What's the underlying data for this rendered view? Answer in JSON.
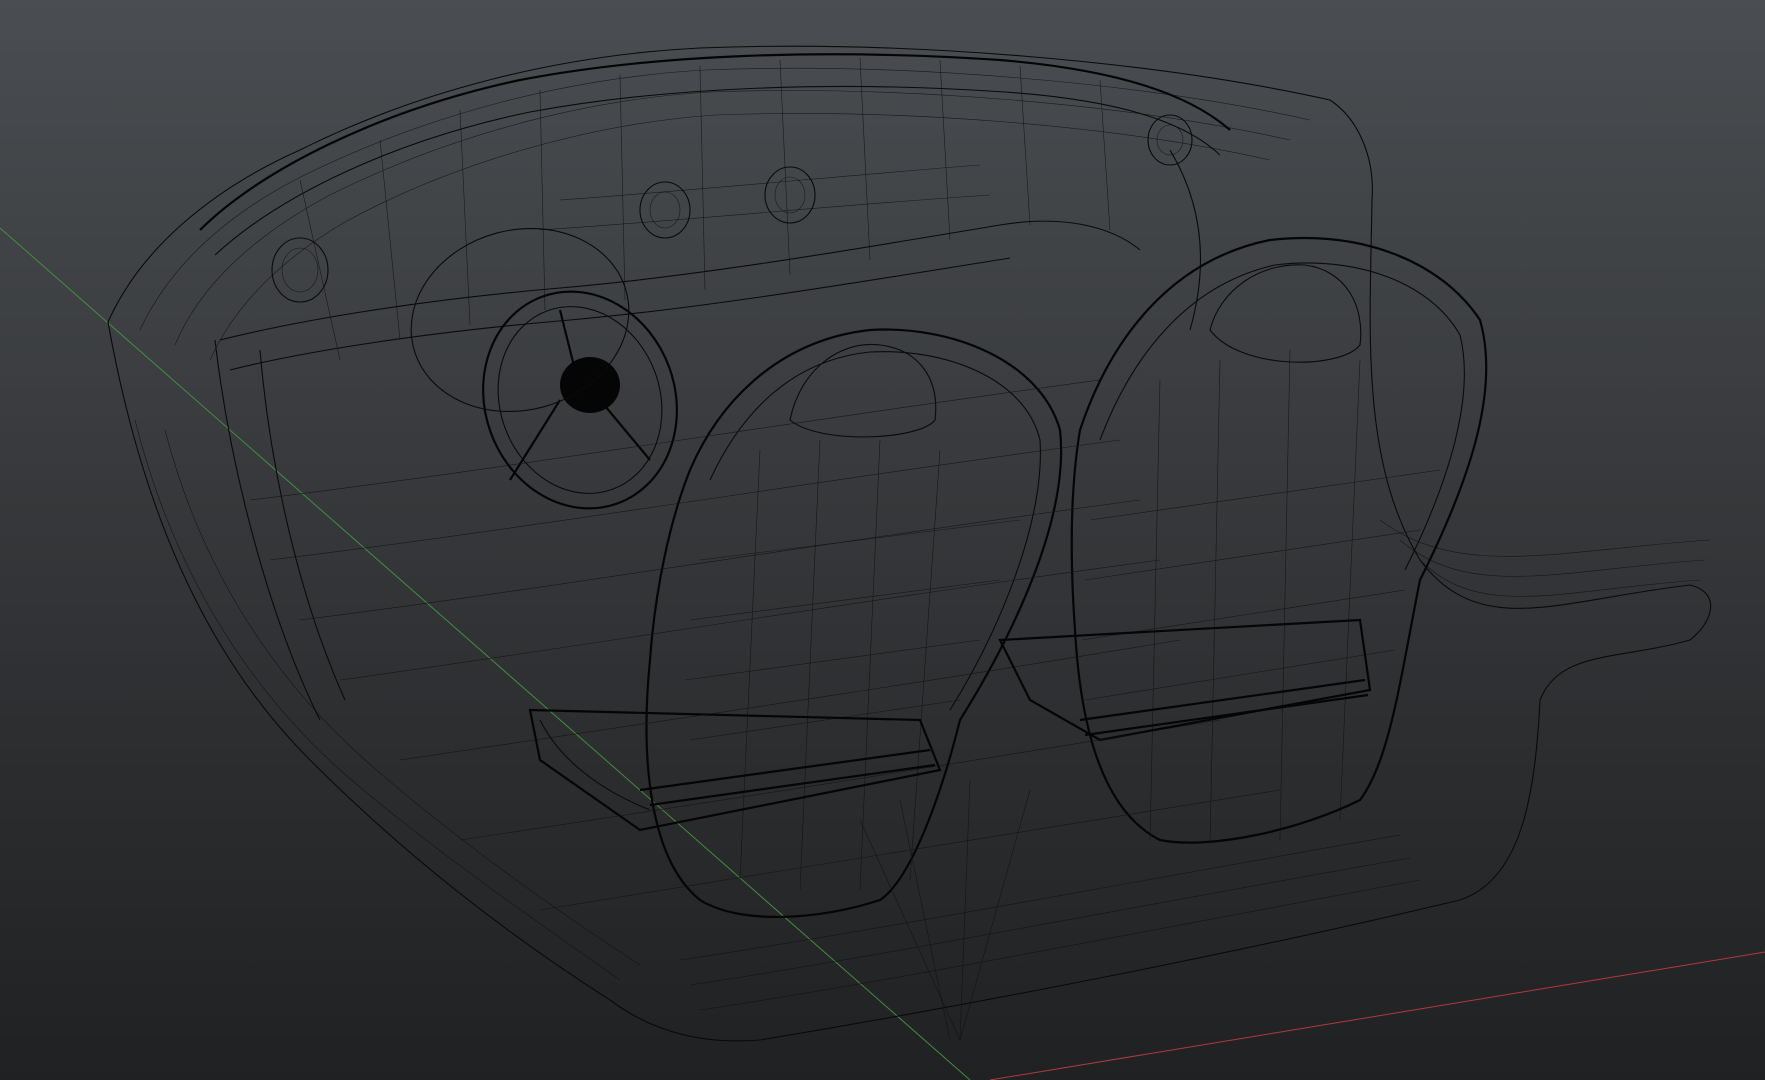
{
  "viewport": {
    "name": "3d-wireframe-viewport",
    "background_top": "#4a4d51",
    "background_bottom": "#202122",
    "wire_color": "#0b0b0b",
    "axis_x_color": "#b23a3a",
    "axis_z_color": "#3f8f3f",
    "model": "car-interior-wireframe",
    "parts": [
      "dashboard",
      "steering-wheel",
      "air-vents",
      "driver-seat",
      "passenger-seat",
      "floor-tub"
    ]
  }
}
